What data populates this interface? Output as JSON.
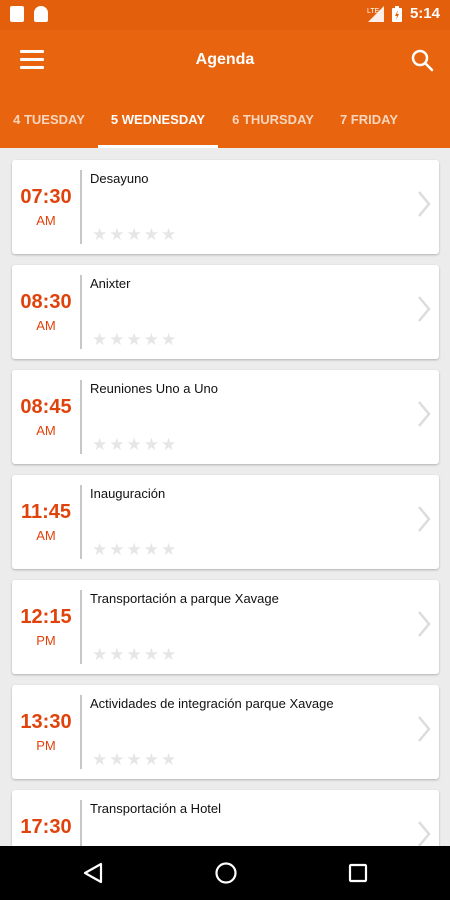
{
  "status_bar": {
    "time": "5:14",
    "network": "LTE"
  },
  "app_bar": {
    "title": "Agenda"
  },
  "tabs": [
    {
      "label": "4 TUESDAY",
      "active": false
    },
    {
      "label": "5 WEDNESDAY",
      "active": true
    },
    {
      "label": "6 THURSDAY",
      "active": false
    },
    {
      "label": "7 FRIDAY",
      "active": false
    }
  ],
  "events": [
    {
      "time": "07:30",
      "ampm": "AM",
      "title": "Desayuno",
      "rating": 0
    },
    {
      "time": "08:30",
      "ampm": "AM",
      "title": "Anixter",
      "rating": 0
    },
    {
      "time": "08:45",
      "ampm": "AM",
      "title": "Reuniones Uno a Uno",
      "rating": 0
    },
    {
      "time": "11:45",
      "ampm": "AM",
      "title": "Inauguración",
      "rating": 0
    },
    {
      "time": "12:15",
      "ampm": "PM",
      "title": "Transportación a parque Xavage",
      "rating": 0
    },
    {
      "time": "13:30",
      "ampm": "PM",
      "title": "Actividades de integración parque Xavage",
      "rating": 0
    },
    {
      "time": "17:30",
      "ampm": "",
      "title": "Transportación a Hotel",
      "rating": 0
    }
  ],
  "colors": {
    "primary": "#e8640f",
    "status_bar": "#e35f0c",
    "accent": "#e0420b"
  }
}
